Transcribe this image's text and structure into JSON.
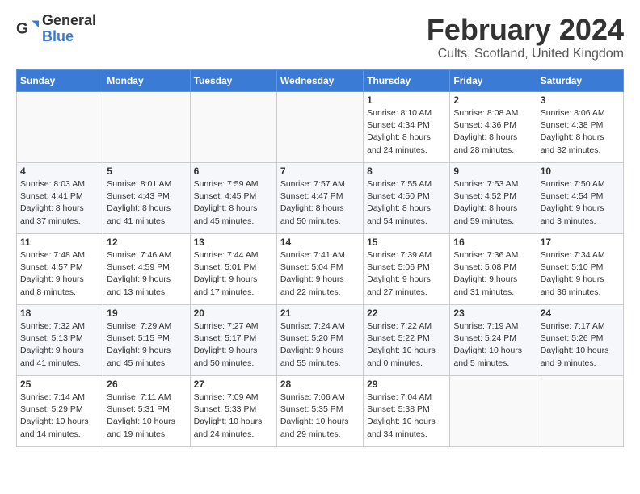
{
  "logo": {
    "general": "General",
    "blue": "Blue"
  },
  "title": "February 2024",
  "subtitle": "Cults, Scotland, United Kingdom",
  "headers": [
    "Sunday",
    "Monday",
    "Tuesday",
    "Wednesday",
    "Thursday",
    "Friday",
    "Saturday"
  ],
  "weeks": [
    [
      {
        "day": "",
        "info": ""
      },
      {
        "day": "",
        "info": ""
      },
      {
        "day": "",
        "info": ""
      },
      {
        "day": "",
        "info": ""
      },
      {
        "day": "1",
        "info": "Sunrise: 8:10 AM\nSunset: 4:34 PM\nDaylight: 8 hours\nand 24 minutes."
      },
      {
        "day": "2",
        "info": "Sunrise: 8:08 AM\nSunset: 4:36 PM\nDaylight: 8 hours\nand 28 minutes."
      },
      {
        "day": "3",
        "info": "Sunrise: 8:06 AM\nSunset: 4:38 PM\nDaylight: 8 hours\nand 32 minutes."
      }
    ],
    [
      {
        "day": "4",
        "info": "Sunrise: 8:03 AM\nSunset: 4:41 PM\nDaylight: 8 hours\nand 37 minutes."
      },
      {
        "day": "5",
        "info": "Sunrise: 8:01 AM\nSunset: 4:43 PM\nDaylight: 8 hours\nand 41 minutes."
      },
      {
        "day": "6",
        "info": "Sunrise: 7:59 AM\nSunset: 4:45 PM\nDaylight: 8 hours\nand 45 minutes."
      },
      {
        "day": "7",
        "info": "Sunrise: 7:57 AM\nSunset: 4:47 PM\nDaylight: 8 hours\nand 50 minutes."
      },
      {
        "day": "8",
        "info": "Sunrise: 7:55 AM\nSunset: 4:50 PM\nDaylight: 8 hours\nand 54 minutes."
      },
      {
        "day": "9",
        "info": "Sunrise: 7:53 AM\nSunset: 4:52 PM\nDaylight: 8 hours\nand 59 minutes."
      },
      {
        "day": "10",
        "info": "Sunrise: 7:50 AM\nSunset: 4:54 PM\nDaylight: 9 hours\nand 3 minutes."
      }
    ],
    [
      {
        "day": "11",
        "info": "Sunrise: 7:48 AM\nSunset: 4:57 PM\nDaylight: 9 hours\nand 8 minutes."
      },
      {
        "day": "12",
        "info": "Sunrise: 7:46 AM\nSunset: 4:59 PM\nDaylight: 9 hours\nand 13 minutes."
      },
      {
        "day": "13",
        "info": "Sunrise: 7:44 AM\nSunset: 5:01 PM\nDaylight: 9 hours\nand 17 minutes."
      },
      {
        "day": "14",
        "info": "Sunrise: 7:41 AM\nSunset: 5:04 PM\nDaylight: 9 hours\nand 22 minutes."
      },
      {
        "day": "15",
        "info": "Sunrise: 7:39 AM\nSunset: 5:06 PM\nDaylight: 9 hours\nand 27 minutes."
      },
      {
        "day": "16",
        "info": "Sunrise: 7:36 AM\nSunset: 5:08 PM\nDaylight: 9 hours\nand 31 minutes."
      },
      {
        "day": "17",
        "info": "Sunrise: 7:34 AM\nSunset: 5:10 PM\nDaylight: 9 hours\nand 36 minutes."
      }
    ],
    [
      {
        "day": "18",
        "info": "Sunrise: 7:32 AM\nSunset: 5:13 PM\nDaylight: 9 hours\nand 41 minutes."
      },
      {
        "day": "19",
        "info": "Sunrise: 7:29 AM\nSunset: 5:15 PM\nDaylight: 9 hours\nand 45 minutes."
      },
      {
        "day": "20",
        "info": "Sunrise: 7:27 AM\nSunset: 5:17 PM\nDaylight: 9 hours\nand 50 minutes."
      },
      {
        "day": "21",
        "info": "Sunrise: 7:24 AM\nSunset: 5:20 PM\nDaylight: 9 hours\nand 55 minutes."
      },
      {
        "day": "22",
        "info": "Sunrise: 7:22 AM\nSunset: 5:22 PM\nDaylight: 10 hours\nand 0 minutes."
      },
      {
        "day": "23",
        "info": "Sunrise: 7:19 AM\nSunset: 5:24 PM\nDaylight: 10 hours\nand 5 minutes."
      },
      {
        "day": "24",
        "info": "Sunrise: 7:17 AM\nSunset: 5:26 PM\nDaylight: 10 hours\nand 9 minutes."
      }
    ],
    [
      {
        "day": "25",
        "info": "Sunrise: 7:14 AM\nSunset: 5:29 PM\nDaylight: 10 hours\nand 14 minutes."
      },
      {
        "day": "26",
        "info": "Sunrise: 7:11 AM\nSunset: 5:31 PM\nDaylight: 10 hours\nand 19 minutes."
      },
      {
        "day": "27",
        "info": "Sunrise: 7:09 AM\nSunset: 5:33 PM\nDaylight: 10 hours\nand 24 minutes."
      },
      {
        "day": "28",
        "info": "Sunrise: 7:06 AM\nSunset: 5:35 PM\nDaylight: 10 hours\nand 29 minutes."
      },
      {
        "day": "29",
        "info": "Sunrise: 7:04 AM\nSunset: 5:38 PM\nDaylight: 10 hours\nand 34 minutes."
      },
      {
        "day": "",
        "info": ""
      },
      {
        "day": "",
        "info": ""
      }
    ]
  ]
}
